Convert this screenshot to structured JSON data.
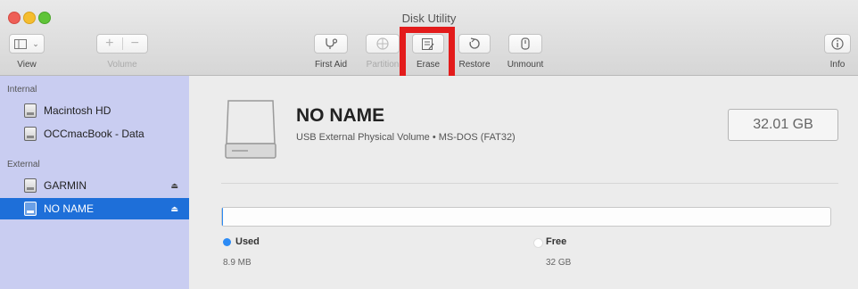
{
  "window": {
    "title": "Disk Utility"
  },
  "toolbar": {
    "view_label": "View",
    "volume_label": "Volume",
    "first_aid_label": "First Aid",
    "partition_label": "Partition",
    "erase_label": "Erase",
    "restore_label": "Restore",
    "unmount_label": "Unmount",
    "info_label": "Info",
    "highlight_color": "#e31b1b"
  },
  "sidebar": {
    "internal_header": "Internal",
    "external_header": "External",
    "internal_items": [
      {
        "label": "Macintosh HD",
        "icon": "internal-disk-icon"
      },
      {
        "label": "OCCmacBook - Data",
        "icon": "internal-disk-icon"
      }
    ],
    "external_items": [
      {
        "label": "GARMIN",
        "icon": "external-disk-icon",
        "eject": "⏏"
      },
      {
        "label": "NO NAME",
        "icon": "external-disk-icon",
        "eject": "⏏",
        "selected": true
      }
    ],
    "selection_color": "#1e6fd9",
    "background_color": "#c9cdf1"
  },
  "volume": {
    "name": "NO NAME",
    "description": "USB External Physical Volume • MS-DOS (FAT32)",
    "capacity": "32.01 GB",
    "used_title": "Used",
    "used_value": "8.9 MB",
    "free_title": "Free",
    "free_value": "32 GB",
    "used_fraction": 0.0003,
    "used_color": "#2c8bf5",
    "free_color": "#ffffff"
  }
}
